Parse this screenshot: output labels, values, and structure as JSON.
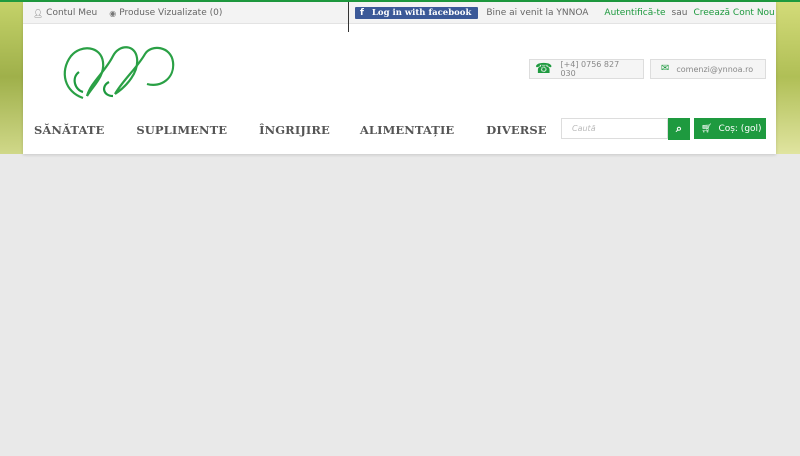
{
  "topbar": {
    "account_label": "Contul Meu",
    "viewed_label": "Produse Vizualizate (0)",
    "facebook_label": "Log in with facebook",
    "welcome": "Bine ai venit la YNNOA",
    "login_link": "Autentifică-te",
    "or": "sau",
    "register_link": "Creează Cont Nou"
  },
  "contact": {
    "phone": "[+4] 0756 827 030",
    "email": "comenzi@ynnoa.ro"
  },
  "nav": {
    "items": [
      {
        "label": "SĂNĂTATE"
      },
      {
        "label": "SUPLIMENTE"
      },
      {
        "label": "ÎNGRIJIRE"
      },
      {
        "label": "ALIMENTAȚIE"
      },
      {
        "label": "DIVERSE"
      }
    ]
  },
  "search": {
    "placeholder": "Caută"
  },
  "cart": {
    "label": "Coș: (gol)"
  },
  "colors": {
    "brand_green": "#1e9a3f",
    "facebook_blue": "#3b5998"
  },
  "icons": [
    "user-icon",
    "eye-icon",
    "facebook-icon",
    "headset-icon",
    "envelope-icon",
    "search-icon",
    "cart-icon"
  ]
}
